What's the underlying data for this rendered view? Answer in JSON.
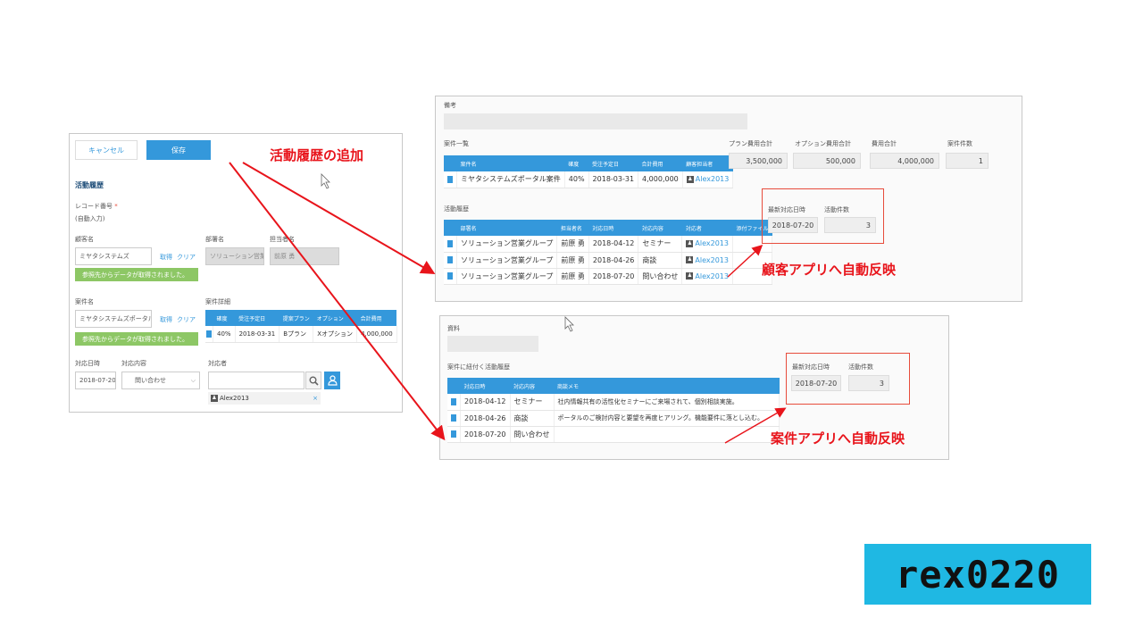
{
  "left_form": {
    "cancel_label": "キャンセル",
    "save_label": "保存",
    "section_title": "活動履歴",
    "record_number_label": "レコード番号",
    "required_mark": "*",
    "record_number_value": "(自動入力)",
    "customer_label": "顧客名",
    "customer_value": "ミヤタシステムズ",
    "fetch_label": "取得",
    "clear_label": "クリア",
    "dept_label": "部署名",
    "dept_value": "ソリューション営業",
    "owner_label": "担当者名",
    "owner_value": "前原 勇",
    "notice_text": "参照先からデータが取得されました。",
    "case_label": "案件名",
    "case_value": "ミヤタシステムズポータル系",
    "case_detail_label": "案件詳細",
    "case_detail_headers": [
      "確度",
      "受注予定日",
      "提案プラン",
      "オプション",
      "合計費用"
    ],
    "case_detail_row": [
      "40%",
      "2018-03-31",
      "Bプラン",
      "Xオプション",
      "4,000,000"
    ],
    "date_label": "対応日時",
    "date_value": "2018-07-20",
    "content_label": "対応内容",
    "content_value": "問い合わせ",
    "person_label": "対応者",
    "person_user": "Alex2013",
    "remove_mark": "×"
  },
  "customer_app": {
    "note_label": "備考",
    "case_list_label": "案件一覧",
    "case_headers": [
      "案件名",
      "確度",
      "受注予定日",
      "合計費用",
      "顧客担当者"
    ],
    "case_rows": [
      [
        "ミヤタシステムズポータル案件",
        "40%",
        "2018-03-31",
        "4,000,000",
        "Alex2013"
      ]
    ],
    "plan_total_label": "プラン費用合計",
    "plan_total_value": "3,500,000",
    "option_total_label": "オプション費用合計",
    "option_total_value": "500,000",
    "cost_total_label": "費用合計",
    "cost_total_value": "4,000,000",
    "case_count_label": "案件件数",
    "case_count_value": "1",
    "activity_label": "活動履歴",
    "activity_headers": [
      "部署名",
      "担当者名",
      "対応日時",
      "対応内容",
      "対応者",
      "添付ファイル"
    ],
    "activity_rows": [
      [
        "ソリューション営業グループ",
        "前原 勇",
        "2018-04-12",
        "セミナー",
        "Alex2013"
      ],
      [
        "ソリューション営業グループ",
        "前原 勇",
        "2018-04-26",
        "商談",
        "Alex2013"
      ],
      [
        "ソリューション営業グループ",
        "前原 勇",
        "2018-07-20",
        "問い合わせ",
        "Alex2013"
      ]
    ],
    "latest_date_label": "最新対応日時",
    "latest_date_value": "2018-07-20",
    "activity_count_label": "活動件数",
    "activity_count_value": "3"
  },
  "case_app": {
    "material_label": "資料",
    "history_label": "案件に紐付く活動履歴",
    "history_headers": [
      "対応日時",
      "対応内容",
      "商談メモ"
    ],
    "history_rows": [
      [
        "2018-04-12",
        "セミナー",
        "社内情報共有の活性化セミナーにご来場されて、個別相談実施。"
      ],
      [
        "2018-04-26",
        "商談",
        "ポータルのご検討内容と要望を再度ヒアリング。機能要件に落とし込む。"
      ],
      [
        "2018-07-20",
        "問い合わせ",
        ""
      ]
    ],
    "latest_date_label": "最新対応日時",
    "latest_date_value": "2018-07-20",
    "activity_count_label": "活動件数",
    "activity_count_value": "3"
  },
  "annotations": {
    "add_activity": "活動履歴の追加",
    "to_customer": "顧客アプリへ自動反映",
    "to_case": "案件アプリへ自動反映"
  },
  "logo_text": "rex0220",
  "colors": {
    "accent": "#3498db",
    "annotation": "#e8141b",
    "notice": "#8dc765",
    "logo_bg": "#1fb8e3"
  }
}
